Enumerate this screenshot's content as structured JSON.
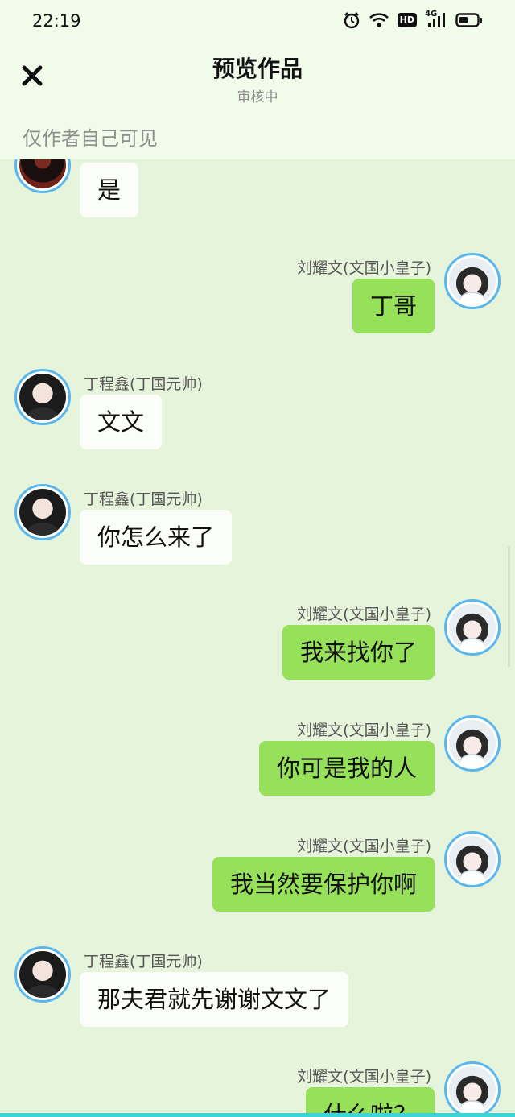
{
  "status_bar": {
    "time": "22:19",
    "hd_label": "HD",
    "network_label": "4G"
  },
  "header": {
    "title": "预览作品",
    "subtitle": "审核中",
    "visibility_note": "仅作者自己可见"
  },
  "colors": {
    "sent_bubble": "#96e05a",
    "received_bubble": "#fbfdf9",
    "avatar_ring": "#59b7ee",
    "background": "#e6f4db"
  },
  "messages": [
    {
      "side": "left",
      "sender": "",
      "text": "是"
    },
    {
      "side": "right",
      "sender": "刘耀文(文国小皇子)",
      "text": "丁哥"
    },
    {
      "side": "left",
      "sender": "丁程鑫(丁国元帅)",
      "text": "文文"
    },
    {
      "side": "left",
      "sender": "丁程鑫(丁国元帅)",
      "text": "你怎么来了"
    },
    {
      "side": "right",
      "sender": "刘耀文(文国小皇子)",
      "text": "我来找你了"
    },
    {
      "side": "right",
      "sender": "刘耀文(文国小皇子)",
      "text": "你可是我的人"
    },
    {
      "side": "right",
      "sender": "刘耀文(文国小皇子)",
      "text": "我当然要保护你啊"
    },
    {
      "side": "left",
      "sender": "丁程鑫(丁国元帅)",
      "text": "那夫君就先谢谢文文了"
    },
    {
      "side": "right",
      "sender": "刘耀文(文国小皇子)",
      "text": "什么啦？"
    }
  ]
}
